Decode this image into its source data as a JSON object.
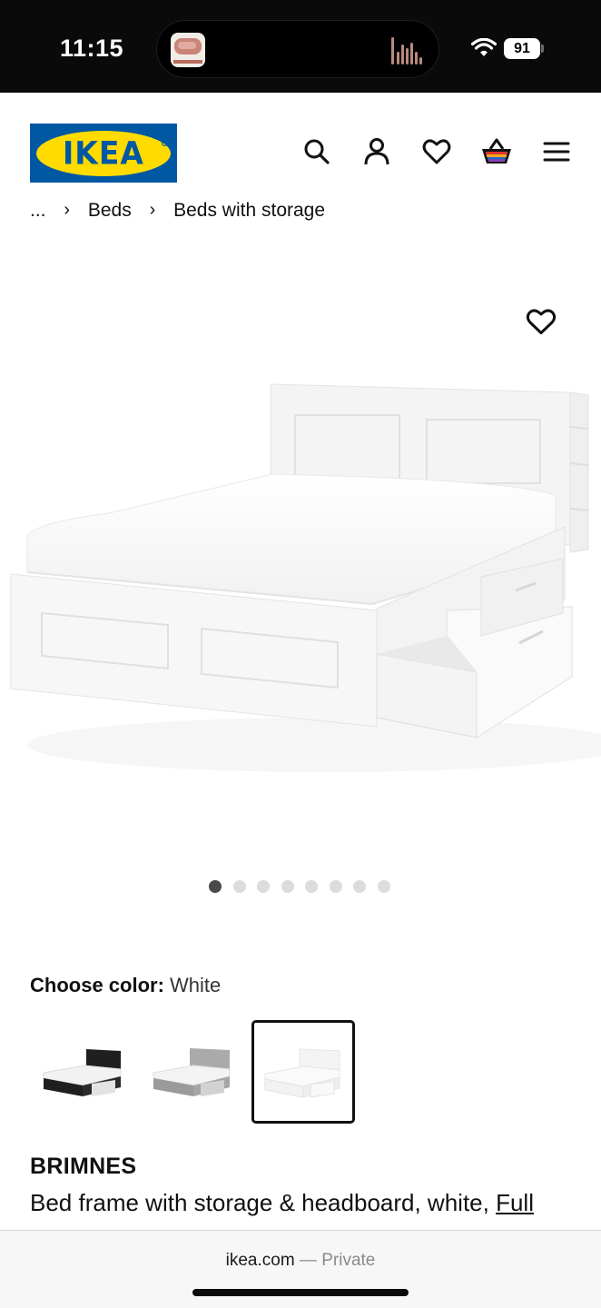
{
  "status_bar": {
    "time": "11:15",
    "battery": "91",
    "icons": [
      "now-playing-thumbnail",
      "audio-waveform-icon",
      "wifi-icon",
      "battery-icon"
    ]
  },
  "header": {
    "logo_text": "IKEA",
    "brand_colors": {
      "blue": "#0058a3",
      "yellow": "#ffdb00"
    },
    "icons": [
      "search-icon",
      "account-icon",
      "heart-icon",
      "cart-icon",
      "menu-icon"
    ]
  },
  "breadcrumb": {
    "items": [
      "...",
      "Beds",
      "Beds with storage"
    ]
  },
  "gallery": {
    "slide_count": 8,
    "active_slide": 1
  },
  "color_selector": {
    "label": "Choose color:",
    "selected_value": "White",
    "options": [
      {
        "color": "#1f1f1f",
        "selected": false
      },
      {
        "color": "#9a9a9a",
        "selected": false
      },
      {
        "color": "#f4f4f4",
        "selected": true
      }
    ]
  },
  "product": {
    "name": "BRIMNES",
    "description": "Bed frame with storage & headboard, white,",
    "size_link": "Full"
  },
  "browser": {
    "domain": "ikea.com",
    "separator": " — ",
    "mode": "Private"
  }
}
